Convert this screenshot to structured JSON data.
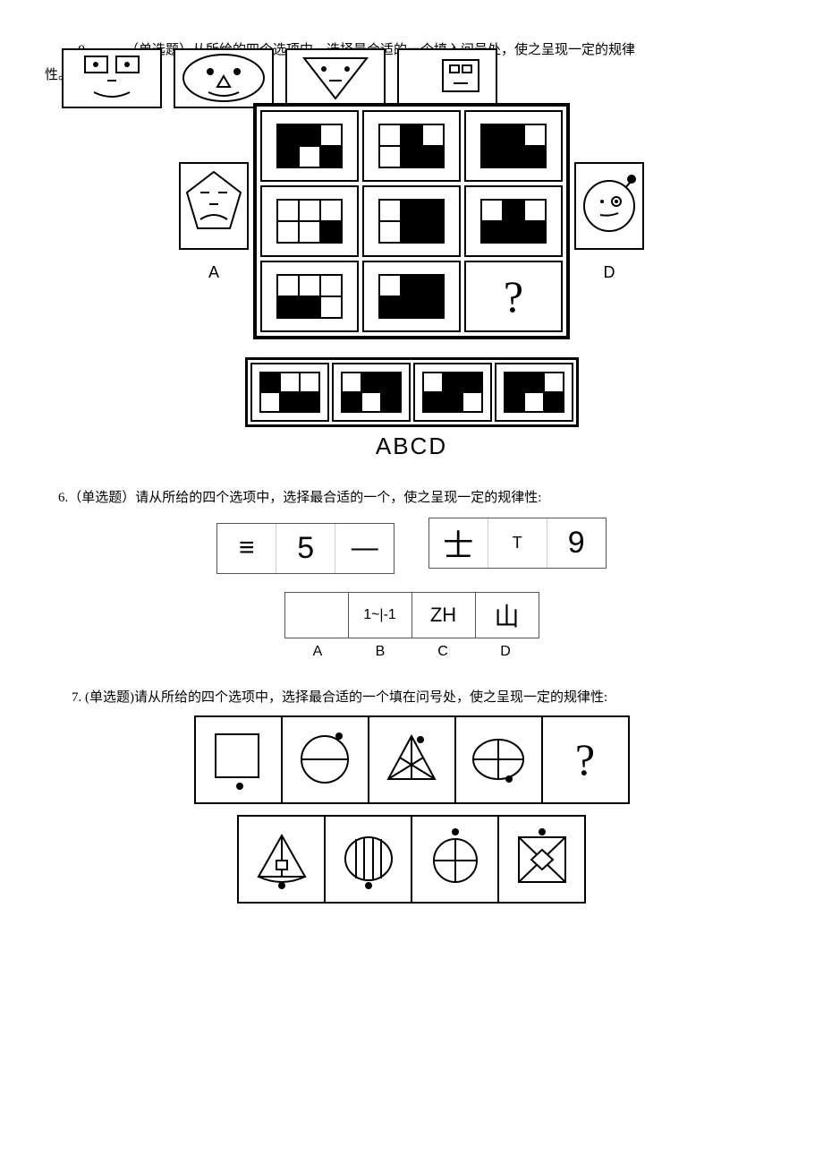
{
  "q5": {
    "number": "9",
    "prefix": "．（单选题）从所给的四个选项中，选择最合适的一个填入问号处，使之呈现一定的规律",
    "suffix": "性。",
    "opt_a": "A",
    "opt_d": "D",
    "abcd": "ABCD",
    "matrix": [
      [
        [
          1,
          1,
          0,
          1,
          0,
          1
        ],
        [
          0,
          1,
          0,
          0,
          1,
          1
        ],
        [
          1,
          1,
          0,
          1,
          1,
          1
        ]
      ],
      [
        [
          0,
          0,
          0,
          0,
          0,
          1
        ],
        [
          0,
          1,
          1,
          0,
          1,
          1
        ],
        [
          0,
          1,
          0,
          1,
          1,
          1
        ]
      ],
      [
        [
          0,
          0,
          0,
          1,
          1,
          0
        ],
        [
          0,
          1,
          1,
          1,
          1,
          1
        ],
        "?"
      ]
    ],
    "options": [
      [
        1,
        0,
        0,
        0,
        1,
        1
      ],
      [
        0,
        1,
        1,
        1,
        0,
        1
      ],
      [
        0,
        1,
        1,
        1,
        1,
        0
      ],
      [
        1,
        1,
        0,
        1,
        0,
        1
      ]
    ]
  },
  "q6": {
    "text": "6.（单选题）请从所给的四个选项中，选择最合适的一个，使之呈现一定的规律性:",
    "row1": [
      "≡",
      "5",
      "—"
    ],
    "row2": [
      "士",
      "T",
      "9"
    ],
    "opts": [
      "",
      "1~|-1",
      "ZH",
      "山"
    ],
    "labels": [
      "A",
      "B",
      "C",
      "D"
    ]
  },
  "q7": {
    "text": "7. (单选题)请从所给的四个选项中，选择最合适的一个填在问号处，使之呈现一定的规律性:",
    "qmark": "?"
  }
}
